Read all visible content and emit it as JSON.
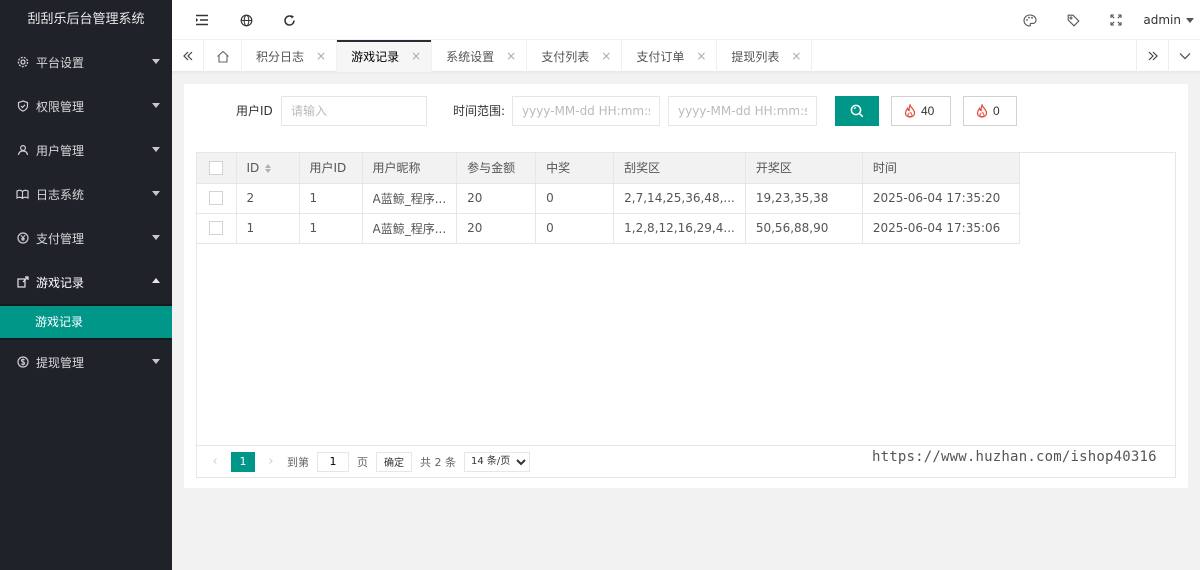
{
  "app": {
    "title": "刮刮乐后台管理系统"
  },
  "sidebar": {
    "items": [
      {
        "label": "平台设置",
        "icon": "gear-icon"
      },
      {
        "label": "权限管理",
        "icon": "shield-icon"
      },
      {
        "label": "用户管理",
        "icon": "user-icon"
      },
      {
        "label": "日志系统",
        "icon": "book-icon"
      },
      {
        "label": "支付管理",
        "icon": "yen-icon"
      },
      {
        "label": "游戏记录",
        "icon": "share-icon"
      },
      {
        "label": "提现管理",
        "icon": "dollar-icon"
      }
    ],
    "open_submenu": {
      "label": "游戏记录"
    }
  },
  "header": {
    "user": "admin"
  },
  "tabs": [
    {
      "label": "积分日志"
    },
    {
      "label": "游戏记录"
    },
    {
      "label": "系统设置"
    },
    {
      "label": "支付列表"
    },
    {
      "label": "支付订单"
    },
    {
      "label": "提现列表"
    }
  ],
  "tab_close": "×",
  "search": {
    "user_id_label": "用户ID",
    "user_id_placeholder": "请输入",
    "time_label": "时间范围:",
    "start_placeholder": "yyyy-MM-dd HH:mm:ss",
    "end_placeholder": "yyyy-MM-dd HH:mm:ss",
    "fire_count_1": "40",
    "fire_count_2": "0"
  },
  "table": {
    "columns": [
      "ID",
      "用户ID",
      "用户昵称",
      "参与金额",
      "中奖",
      "刮奖区",
      "开奖区",
      "时间"
    ],
    "rows": [
      [
        "2",
        "1",
        "A蓝鲸_程序...",
        "20",
        "0",
        "2,7,14,25,36,48,...",
        "19,23,35,38",
        "2025-06-04 17:35:20"
      ],
      [
        "1",
        "1",
        "A蓝鲸_程序...",
        "20",
        "0",
        "1,2,8,12,16,29,4...",
        "50,56,88,90",
        "2025-06-04 17:35:06"
      ]
    ]
  },
  "pager": {
    "prev": "‹",
    "next": "›",
    "current": "1",
    "goto_label": "到第",
    "goto_value": "1",
    "page_unit": "页",
    "confirm": "确定",
    "total": "共 2 条",
    "page_size": "14 条/页"
  },
  "watermark": "https://www.huzhan.com/ishop40316",
  "colors": {
    "accent": "#009688",
    "sidebar_bg": "#20222a",
    "fire": "#e5483c"
  }
}
